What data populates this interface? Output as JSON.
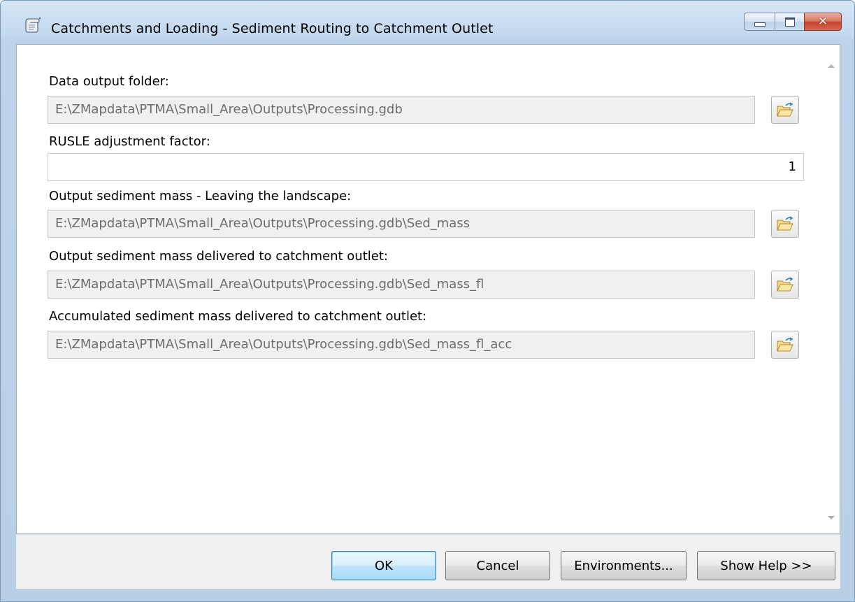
{
  "window": {
    "title": "Catchments and Loading - Sediment Routing to Catchment Outlet",
    "icon": "toolbox-script-icon"
  },
  "params": [
    {
      "label": "Data output folder:",
      "value": "E:\\ZMapdata\\PTMA\\Small_Area\\Outputs\\Processing.gdb",
      "kind": "path"
    },
    {
      "label": "RUSLE adjustment factor:",
      "value": "1",
      "kind": "numeric"
    },
    {
      "label": "Output sediment mass - Leaving the landscape:",
      "value": "E:\\ZMapdata\\PTMA\\Small_Area\\Outputs\\Processing.gdb\\Sed_mass",
      "kind": "path"
    },
    {
      "label": "Output sediment mass delivered to catchment outlet:",
      "value": "E:\\ZMapdata\\PTMA\\Small_Area\\Outputs\\Processing.gdb\\Sed_mass_fl",
      "kind": "path"
    },
    {
      "label": "Accumulated sediment mass delivered to catchment outlet:",
      "value": "E:\\ZMapdata\\PTMA\\Small_Area\\Outputs\\Processing.gdb\\Sed_mass_fl_acc",
      "kind": "path"
    }
  ],
  "buttons": {
    "ok": "OK",
    "cancel": "Cancel",
    "environments": "Environments...",
    "show_help": "Show Help >>"
  },
  "caption": {
    "close_glyph": "✕"
  },
  "colors": {
    "title_bar": "#c3d8ee",
    "close_button": "#c5432b",
    "default_button_border": "#3c7fb1",
    "disabled_field_bg": "#f0f0f0"
  }
}
